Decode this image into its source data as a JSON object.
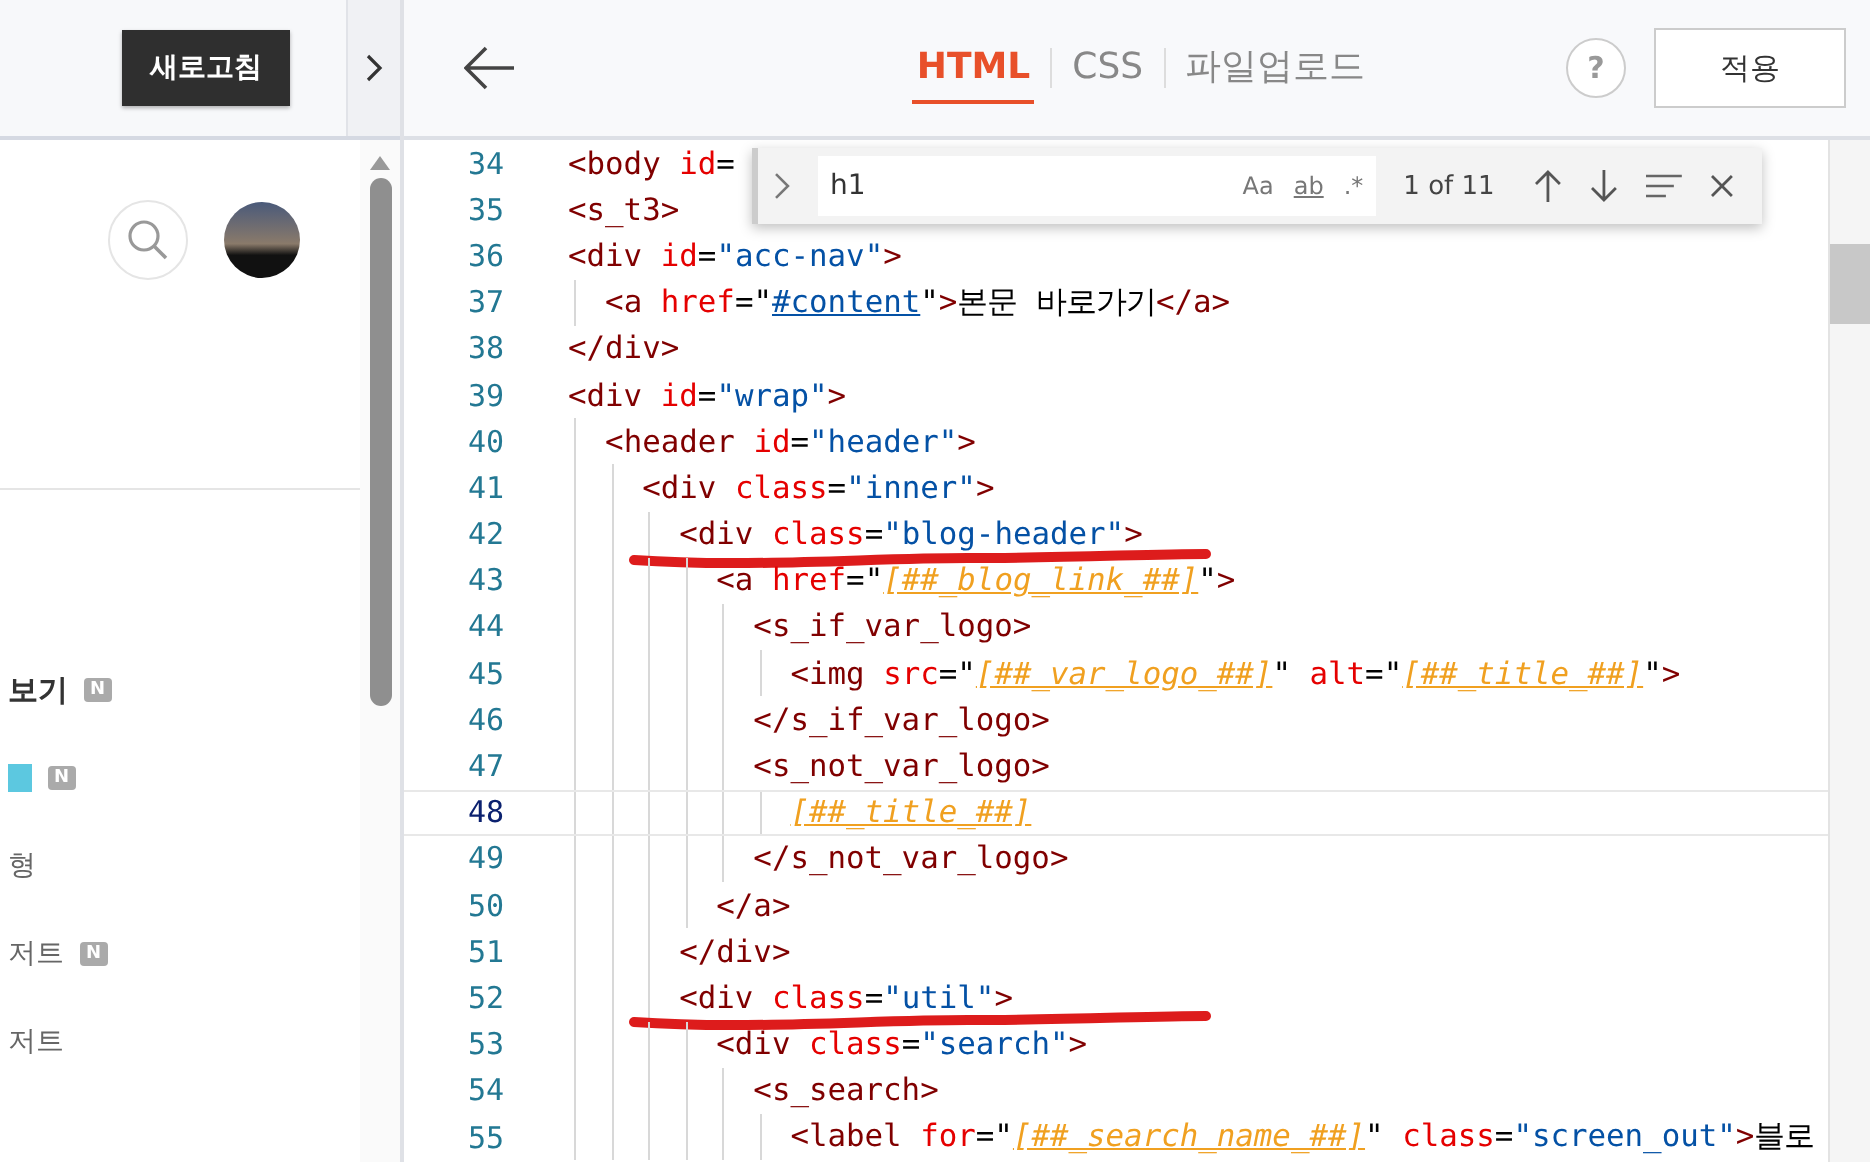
{
  "preview": {
    "refresh_button": "새로고침",
    "menu_items": [
      {
        "kind": "text",
        "text": "보기",
        "bold": true,
        "new": true,
        "badge": "N"
      },
      {
        "kind": "accent",
        "new": true,
        "badge": "N"
      },
      {
        "kind": "text",
        "text": "형",
        "bold": false,
        "new": false
      },
      {
        "kind": "text",
        "text": "저트",
        "bold": false,
        "new": true,
        "badge": "N"
      },
      {
        "kind": "text",
        "text": "저트",
        "bold": false,
        "new": false
      }
    ]
  },
  "header": {
    "tabs": [
      {
        "label": "HTML",
        "selected": true
      },
      {
        "label": "CSS",
        "selected": false
      },
      {
        "label": "파일업로드",
        "selected": false
      }
    ],
    "help": "?",
    "apply_button": "적용"
  },
  "find": {
    "value": "h1",
    "options": [
      "Aa",
      "ab",
      ".*"
    ],
    "count": "1 of 11"
  },
  "code": [
    {
      "n": "34",
      "current": false,
      "marked": false,
      "text": "<body id="
    },
    {
      "n": "35",
      "current": false,
      "marked": false,
      "text": "<s_t3>"
    },
    {
      "n": "36",
      "current": false,
      "marked": false,
      "text": "<div id=\"acc-nav\">"
    },
    {
      "n": "37",
      "current": false,
      "marked": false,
      "text": "  <a href=\"#content\">본문 바로가기</a>"
    },
    {
      "n": "38",
      "current": false,
      "marked": false,
      "text": "</div>"
    },
    {
      "n": "39",
      "current": false,
      "marked": false,
      "text": "<div id=\"wrap\">"
    },
    {
      "n": "40",
      "current": false,
      "marked": false,
      "text": "  <header id=\"header\">"
    },
    {
      "n": "41",
      "current": false,
      "marked": false,
      "text": "    <div class=\"inner\">"
    },
    {
      "n": "42",
      "current": false,
      "marked": true,
      "text": "      <div class=\"blog-header\">"
    },
    {
      "n": "43",
      "current": false,
      "marked": false,
      "text": "        <a href=\"[##_blog_link_##]\">"
    },
    {
      "n": "44",
      "current": false,
      "marked": false,
      "text": "          <s_if_var_logo>"
    },
    {
      "n": "45",
      "current": false,
      "marked": false,
      "text": "            <img src=\"[##_var_logo_##]\" alt=\"[##_title_##]\">"
    },
    {
      "n": "46",
      "current": false,
      "marked": false,
      "text": "          </s_if_var_logo>"
    },
    {
      "n": "47",
      "current": false,
      "marked": false,
      "text": "          <s_not_var_logo>"
    },
    {
      "n": "48",
      "current": true,
      "marked": false,
      "text": "            [##_title_##]"
    },
    {
      "n": "49",
      "current": false,
      "marked": false,
      "text": "          </s_not_var_logo>"
    },
    {
      "n": "50",
      "current": false,
      "marked": false,
      "text": "        </a>"
    },
    {
      "n": "51",
      "current": false,
      "marked": false,
      "text": "      </div>"
    },
    {
      "n": "52",
      "current": false,
      "marked": true,
      "text": "      <div class=\"util\">"
    },
    {
      "n": "53",
      "current": false,
      "marked": false,
      "text": "        <div class=\"search\">"
    },
    {
      "n": "54",
      "current": false,
      "marked": false,
      "text": "          <s_search>"
    },
    {
      "n": "55",
      "current": false,
      "marked": false,
      "text": "            <label for=\"[##_search_name_##]\" class=\"screen_out\">블로"
    }
  ]
}
